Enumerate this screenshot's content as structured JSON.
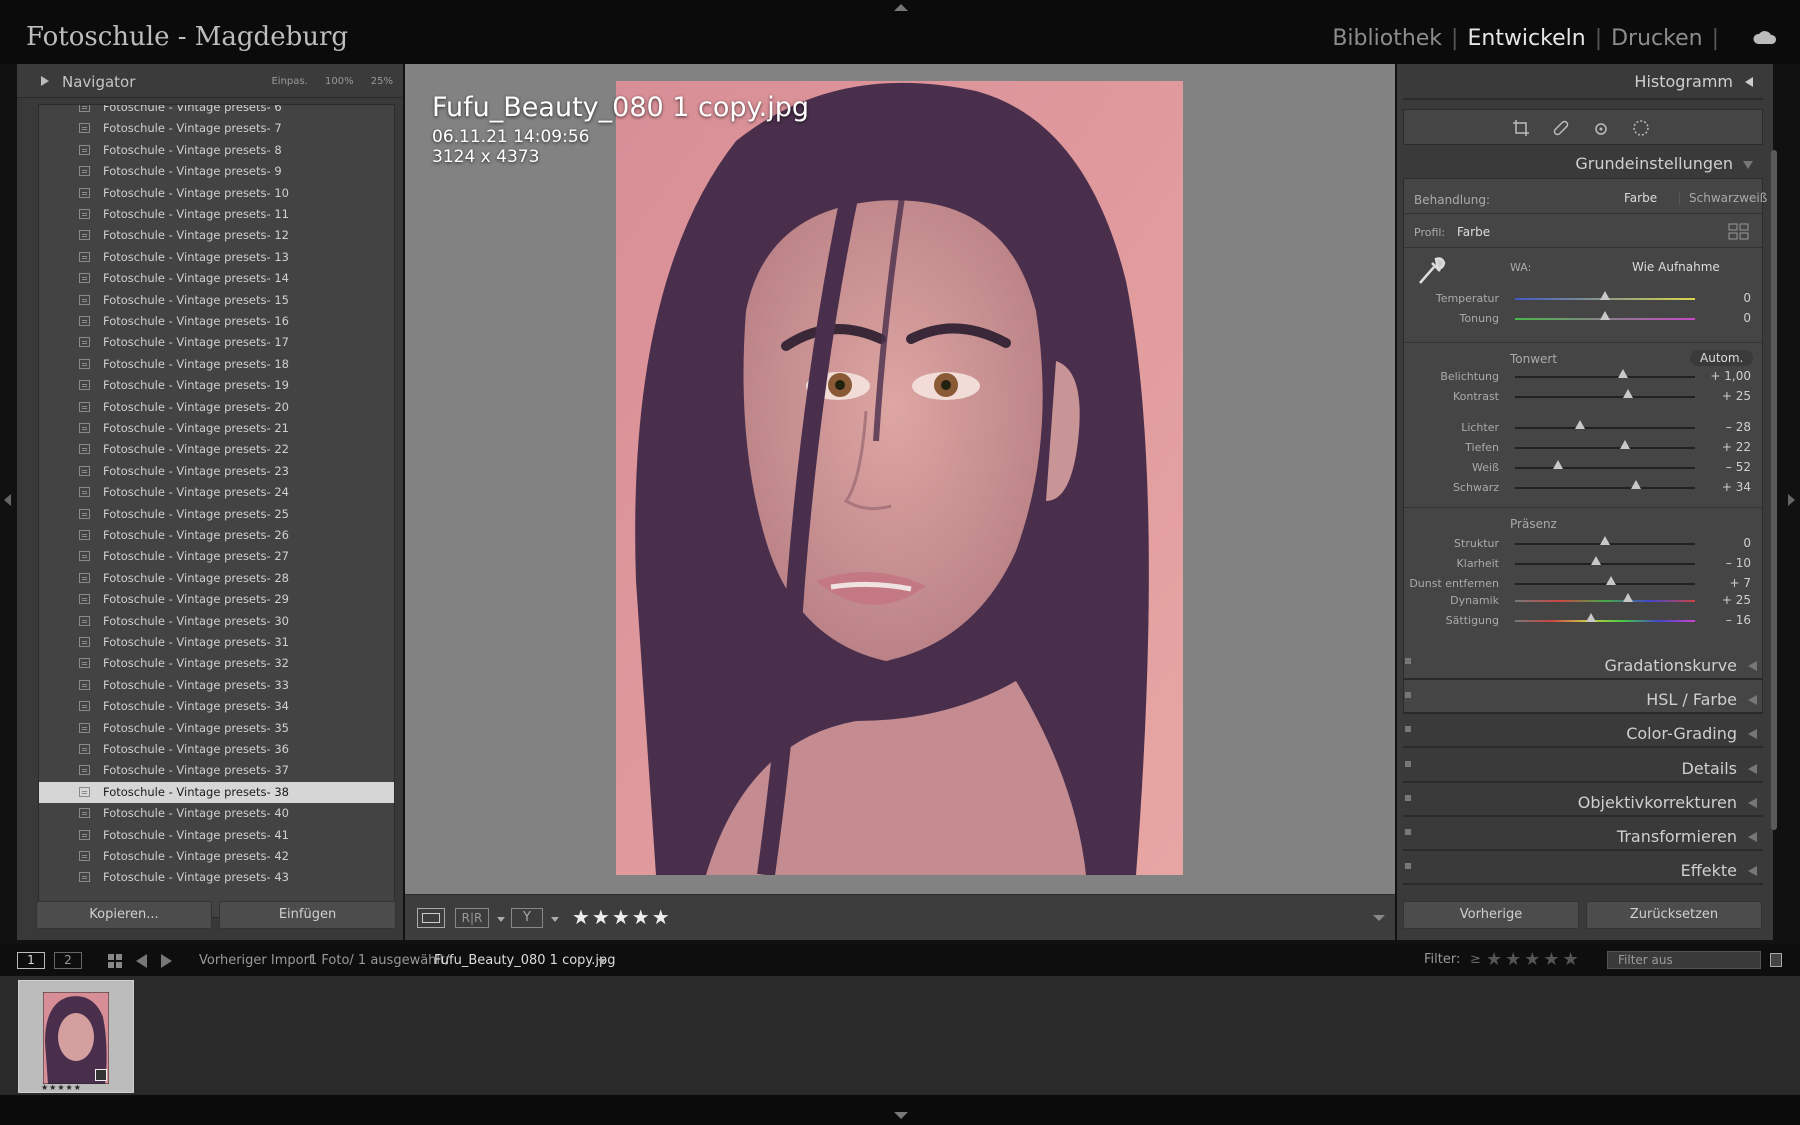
{
  "app": {
    "title": "Fotoschule - Magdeburg"
  },
  "modules": {
    "library": "Bibliothek",
    "develop": "Entwickeln",
    "print": "Drucken"
  },
  "navigator": {
    "title": "Navigator",
    "zoom_fit": "Einpas.",
    "zoom_100": "100%",
    "zoom_25": "25%"
  },
  "presets": [
    {
      "label": "Fotoschule - Vintage presets- 6"
    },
    {
      "label": "Fotoschule - Vintage presets- 7"
    },
    {
      "label": "Fotoschule - Vintage presets- 8"
    },
    {
      "label": "Fotoschule - Vintage presets- 9"
    },
    {
      "label": "Fotoschule - Vintage presets- 10"
    },
    {
      "label": "Fotoschule - Vintage presets- 11"
    },
    {
      "label": "Fotoschule - Vintage presets- 12"
    },
    {
      "label": "Fotoschule - Vintage presets- 13"
    },
    {
      "label": "Fotoschule - Vintage presets- 14"
    },
    {
      "label": "Fotoschule - Vintage presets- 15"
    },
    {
      "label": "Fotoschule - Vintage presets- 16"
    },
    {
      "label": "Fotoschule - Vintage presets- 17"
    },
    {
      "label": "Fotoschule - Vintage presets- 18"
    },
    {
      "label": "Fotoschule - Vintage presets- 19"
    },
    {
      "label": "Fotoschule - Vintage presets- 20"
    },
    {
      "label": "Fotoschule - Vintage presets- 21"
    },
    {
      "label": "Fotoschule - Vintage presets- 22"
    },
    {
      "label": "Fotoschule - Vintage presets- 23"
    },
    {
      "label": "Fotoschule - Vintage presets- 24"
    },
    {
      "label": "Fotoschule - Vintage presets- 25"
    },
    {
      "label": "Fotoschule - Vintage presets- 26"
    },
    {
      "label": "Fotoschule - Vintage presets- 27"
    },
    {
      "label": "Fotoschule - Vintage presets- 28"
    },
    {
      "label": "Fotoschule - Vintage presets- 29"
    },
    {
      "label": "Fotoschule - Vintage presets- 30"
    },
    {
      "label": "Fotoschule - Vintage presets- 31"
    },
    {
      "label": "Fotoschule - Vintage presets- 32"
    },
    {
      "label": "Fotoschule - Vintage presets- 33"
    },
    {
      "label": "Fotoschule - Vintage presets- 34"
    },
    {
      "label": "Fotoschule - Vintage presets- 35"
    },
    {
      "label": "Fotoschule - Vintage presets- 36"
    },
    {
      "label": "Fotoschule - Vintage presets- 37"
    },
    {
      "label": "Fotoschule - Vintage presets- 38",
      "selected": true
    },
    {
      "label": "Fotoschule - Vintage presets- 40"
    },
    {
      "label": "Fotoschule - Vintage presets- 41"
    },
    {
      "label": "Fotoschule - Vintage presets- 42"
    },
    {
      "label": "Fotoschule - Vintage presets- 43"
    }
  ],
  "left_buttons": {
    "copy": "Kopieren...",
    "paste": "Einfügen"
  },
  "photo": {
    "filename": "Fufu_Beauty_080 1 copy.jpg",
    "datetime": "06.11.21 14:09:56",
    "dimensions": "3124 x 4373"
  },
  "toolbar": {
    "rating_stars": "★★★★★"
  },
  "right": {
    "histogram": "Histogramm",
    "basic": "Grundeinstellungen",
    "treatment_label": "Behandlung:",
    "treatment_color": "Farbe",
    "treatment_bw": "Schwarzweiß",
    "profile_label": "Profil:",
    "profile_value": "Farbe",
    "wb_label": "WA:",
    "wb_value": "Wie Aufnahme",
    "tone_label": "Tonwert",
    "auto": "Autom.",
    "presence_label": "Präsenz",
    "wb_sliders": [
      {
        "label": "Temperatur",
        "value": "0",
        "pos": 0.5
      },
      {
        "label": "Tonung",
        "value": "0",
        "pos": 0.5
      }
    ],
    "tone_sliders": [
      {
        "label": "Belichtung",
        "value": "+ 1,00",
        "pos": 0.6
      },
      {
        "label": "Kontrast",
        "value": "+ 25",
        "pos": 0.625
      }
    ],
    "tone_sliders2": [
      {
        "label": "Lichter",
        "value": "– 28",
        "pos": 0.36
      },
      {
        "label": "Tiefen",
        "value": "+ 22",
        "pos": 0.61
      },
      {
        "label": "Weiß",
        "value": "– 52",
        "pos": 0.24
      },
      {
        "label": "Schwarz",
        "value": "+ 34",
        "pos": 0.67
      }
    ],
    "presence_sliders": [
      {
        "label": "Struktur",
        "value": "0",
        "pos": 0.5
      },
      {
        "label": "Klarheit",
        "value": "– 10",
        "pos": 0.45
      },
      {
        "label": "Dunst entfernen",
        "value": "+ 7",
        "pos": 0.535
      }
    ],
    "color_sliders": [
      {
        "label": "Dynamik",
        "value": "+ 25",
        "pos": 0.625
      },
      {
        "label": "Sättigung",
        "value": "– 16",
        "pos": 0.42
      }
    ],
    "collapsed": [
      {
        "label": "Gradationskurve"
      },
      {
        "label": "HSL / Farbe"
      },
      {
        "label": "Color-Grading"
      },
      {
        "label": "Details"
      },
      {
        "label": "Objektivkorrekturen"
      },
      {
        "label": "Transformieren"
      },
      {
        "label": "Effekte"
      }
    ],
    "prev_button": "Vorherige",
    "reset_button": "Zurücksetzen"
  },
  "filmbar": {
    "page1": "1",
    "page2": "2",
    "source": "Vorheriger Import",
    "count": "1 Foto/ 1 ausgewählt/",
    "filename": "Fufu_Beauty_080 1 copy.jpg",
    "filter_label": "Filter:",
    "filter_op": "≥",
    "filter_stars": "★★★★★",
    "filter_value": "Filter aus"
  },
  "thumb": {
    "stars": "★★★★★"
  }
}
